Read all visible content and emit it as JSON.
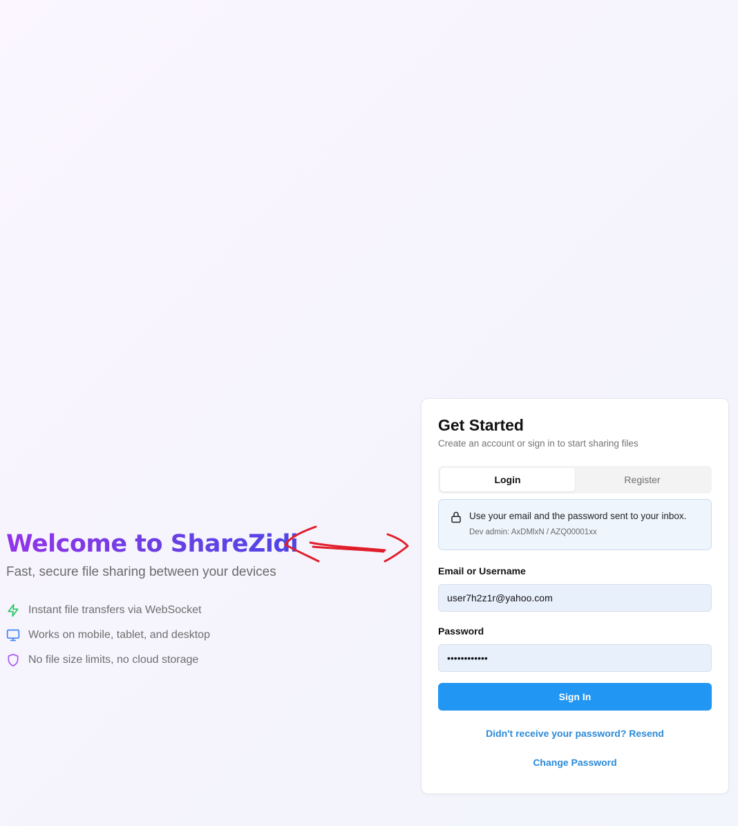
{
  "hero": {
    "title": "Welcome to ShareZidi",
    "subtitle": "Fast, secure file sharing between your devices",
    "features": [
      {
        "icon": "lightning-icon",
        "color": "#22c55e",
        "text": "Instant file transfers via WebSocket"
      },
      {
        "icon": "monitor-icon",
        "color": "#3b82f6",
        "text": "Works on mobile, tablet, and desktop"
      },
      {
        "icon": "shield-icon",
        "color": "#a855f7",
        "text": "No file size limits, no cloud storage"
      }
    ],
    "title_gradient": [
      "#9333ea",
      "#4f46e5"
    ]
  },
  "annotation": {
    "icon": "double-arrow-icon",
    "color": "#e11d2a"
  },
  "card": {
    "title": "Get Started",
    "subtitle": "Create an account or sign in to start sharing files",
    "tabs": [
      {
        "label": "Login",
        "active": true
      },
      {
        "label": "Register",
        "active": false
      }
    ],
    "info": {
      "icon": "lock-icon",
      "text": "Use your email and the password sent to your inbox.",
      "subtext": "Dev admin: AxDMlxN / AZQ00001xx"
    },
    "email": {
      "label": "Email or Username",
      "value": "user7h2z1r@yahoo.com"
    },
    "password": {
      "label": "Password",
      "value": "••••••••••••"
    },
    "sign_in_label": "Sign In",
    "resend_link": "Didn't receive your password? Resend",
    "change_password_link": "Change Password",
    "accent_color": "#2196f3"
  }
}
